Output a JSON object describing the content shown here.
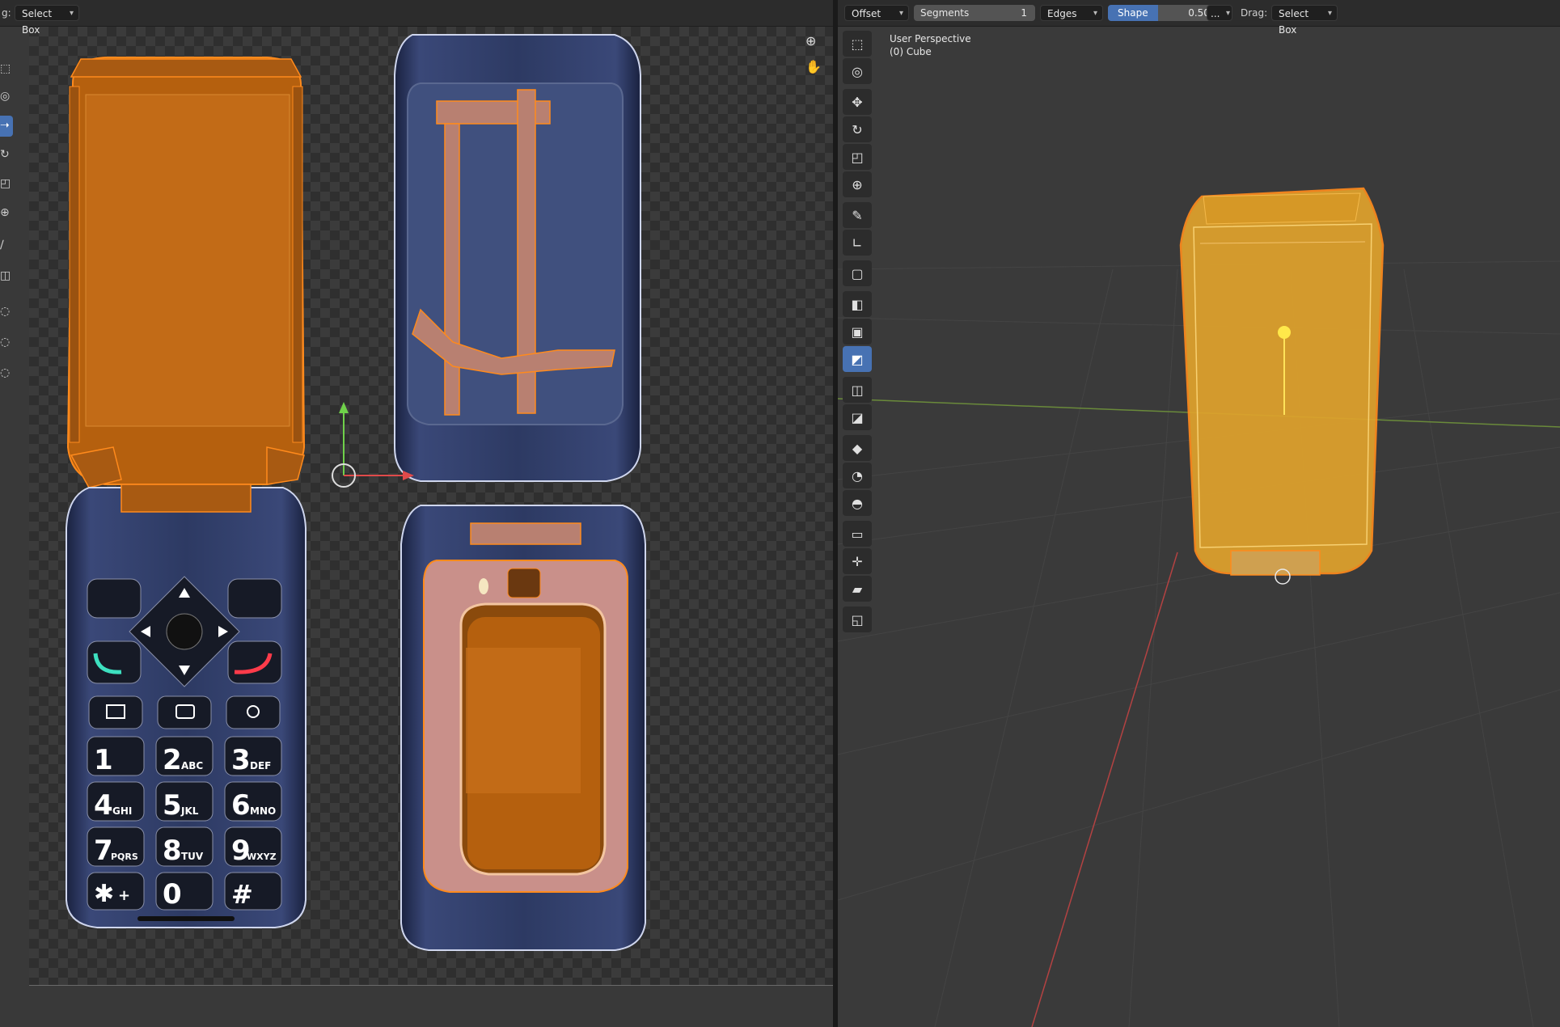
{
  "uv_header": {
    "tool_prefix": "g:",
    "select_mode": "Select Box"
  },
  "viewport_header": {
    "offset_mode": "Offset",
    "segments_label": "Segments",
    "segments_value": "1",
    "affect_mode": "Edges",
    "shape_label": "Shape",
    "shape_value": "0.500",
    "more": "...",
    "drag_label": "Drag:",
    "drag_mode": "Select Box"
  },
  "viewport_overlay": {
    "view_name": "User Perspective",
    "object_name": "(0) Cube"
  },
  "keypad": {
    "row1": [
      {
        "n": "1",
        "l": ""
      },
      {
        "n": "2",
        "l": "ABC"
      },
      {
        "n": "3",
        "l": "DEF"
      }
    ],
    "row2": [
      {
        "n": "4",
        "l": "GHI"
      },
      {
        "n": "5",
        "l": "JKL"
      },
      {
        "n": "6",
        "l": "MNO"
      }
    ],
    "row3": [
      {
        "n": "7",
        "l": "PQRS"
      },
      {
        "n": "8",
        "l": "TUV"
      },
      {
        "n": "9",
        "l": "WXYZ"
      }
    ],
    "row4": [
      {
        "n": "✱",
        "l": "+"
      },
      {
        "n": "0",
        "l": ""
      },
      {
        "n": "#",
        "l": ""
      }
    ]
  },
  "left_tools": [
    "select-box-icon",
    "cursor-icon",
    "move-icon",
    "rotate-icon",
    "scale-icon",
    "transform-icon",
    "annotate-icon",
    "rip-icon",
    "grab-icon",
    "relax-icon",
    "pinch-icon"
  ],
  "right_tools": [
    "select-box-icon",
    "cursor-icon",
    "move-icon",
    "rotate-icon",
    "scale-icon",
    "transform-icon",
    "annotate-icon",
    "measure-icon",
    "add-cube-icon",
    "extrude-icon",
    "inset-icon",
    "bevel-icon",
    "loop-cut-icon",
    "knife-icon",
    "poly-build-icon",
    "spin-icon",
    "smooth-icon",
    "edge-slide-icon",
    "shrink-fatten-icon",
    "shear-icon",
    "rip-region-icon"
  ],
  "colors": {
    "accent": "#4772b3",
    "uv_face": "#b5600e",
    "uv_edge": "#ff8a1c",
    "phone_body": "#2a3558",
    "mesh_fill": "#e0a32c"
  }
}
